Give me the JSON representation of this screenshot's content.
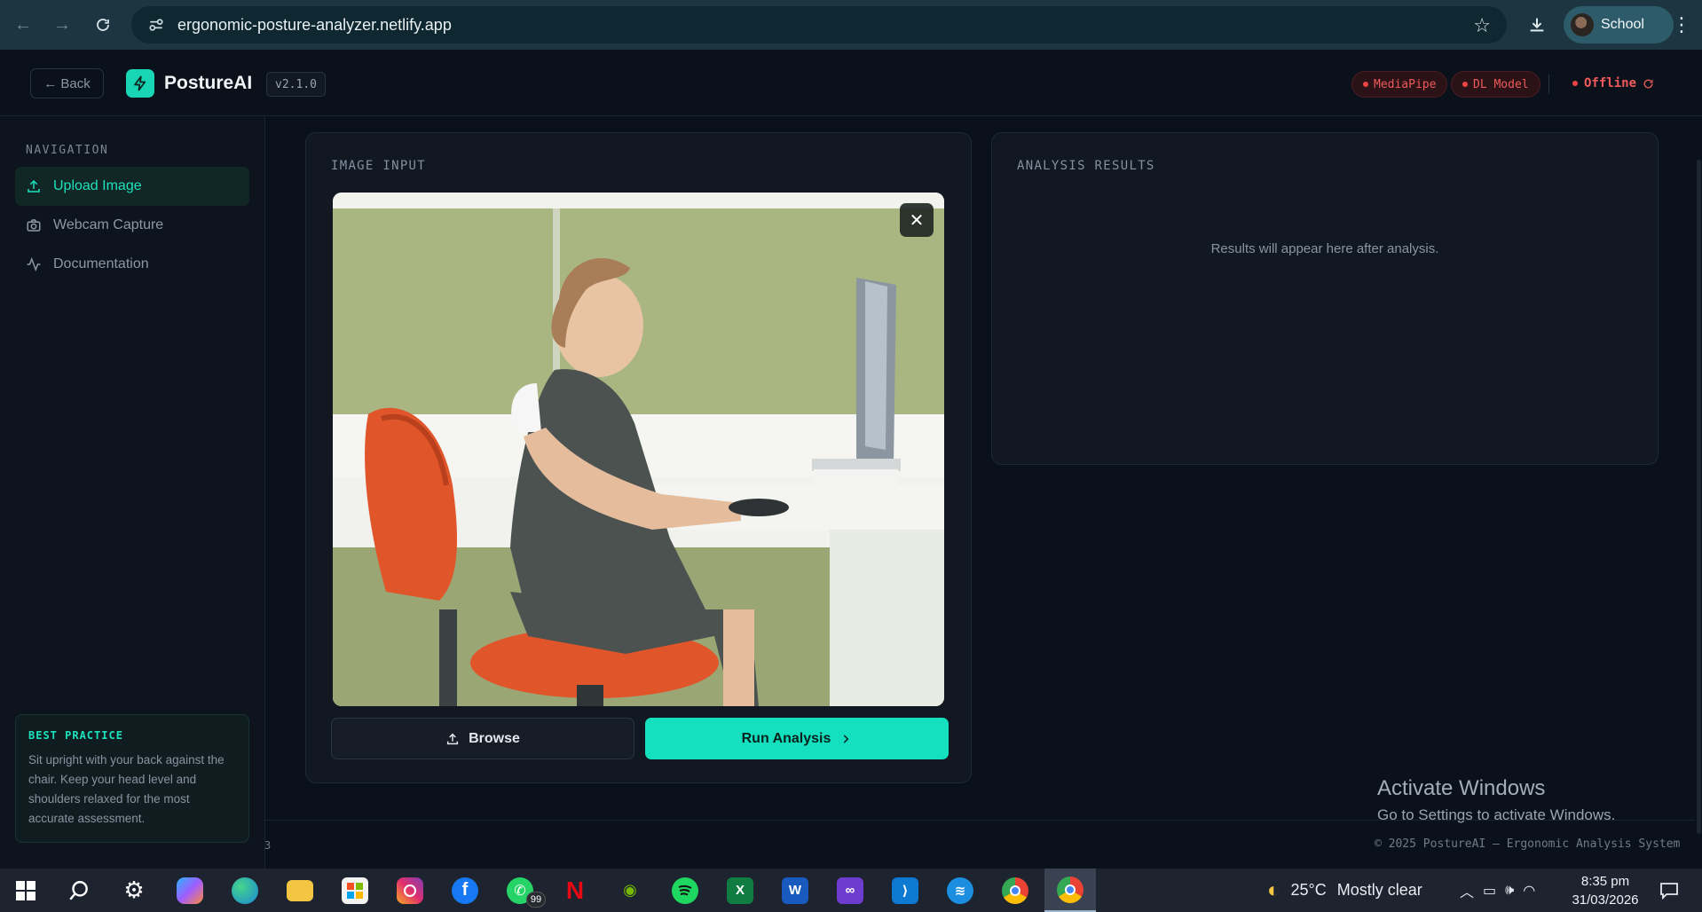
{
  "browser": {
    "url": "ergonomic-posture-analyzer.netlify.app",
    "profile_name": "School"
  },
  "header": {
    "back_label": "← Back",
    "app_name": "PostureAI",
    "version": "v2.1.0",
    "status_mediapipe": "MediaPipe",
    "status_dl_model": "DL Model",
    "connection": "Offline",
    "status_color": "#ef4444",
    "accent_color": "#14e0bf"
  },
  "sidebar": {
    "heading": "NAVIGATION",
    "items": [
      {
        "label": "Upload Image",
        "icon": "upload-icon",
        "active": true
      },
      {
        "label": "Webcam Capture",
        "icon": "camera-icon",
        "active": false
      },
      {
        "label": "Documentation",
        "icon": "activity-icon",
        "active": false
      }
    ],
    "tip": {
      "title": "BEST PRACTICE",
      "body": "Sit upright with your back against the chair. Keep your head level and shoulders relaxed for the most accurate assessment."
    }
  },
  "input_panel": {
    "title": "IMAGE INPUT",
    "close_label": "✕",
    "browse_label": "Browse",
    "run_label": "Run Analysis"
  },
  "results_panel": {
    "title": "ANALYSIS RESULTS",
    "empty_text": "Results will appear here after analysis."
  },
  "footer": {
    "copyright": "© 2025 PostureAI — Ergonomic Analysis System",
    "stray": "3"
  },
  "windows_watermark": {
    "title": "Activate Windows",
    "subtitle": "Go to Settings to activate Windows."
  },
  "taskbar": {
    "whatsapp_badge": "99",
    "weather_temp": "25°C",
    "weather_desc": "Mostly clear",
    "time": "8:35 pm",
    "date": "31/03/2026"
  }
}
